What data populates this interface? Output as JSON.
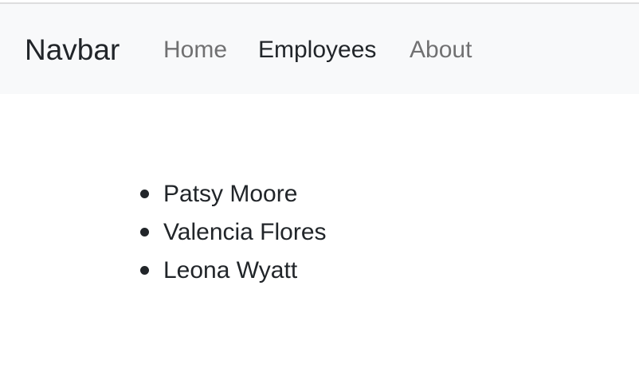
{
  "navbar": {
    "brand": "Navbar",
    "links": [
      {
        "label": "Home",
        "active": false
      },
      {
        "label": "Employees",
        "active": true
      },
      {
        "label": "About",
        "active": false
      }
    ]
  },
  "employees": [
    "Patsy Moore",
    "Valencia Flores",
    "Leona Wyatt"
  ],
  "colors": {
    "navbar_bg": "#f8f9fa",
    "text": "#212529",
    "muted_link": "#8c8c8c"
  }
}
